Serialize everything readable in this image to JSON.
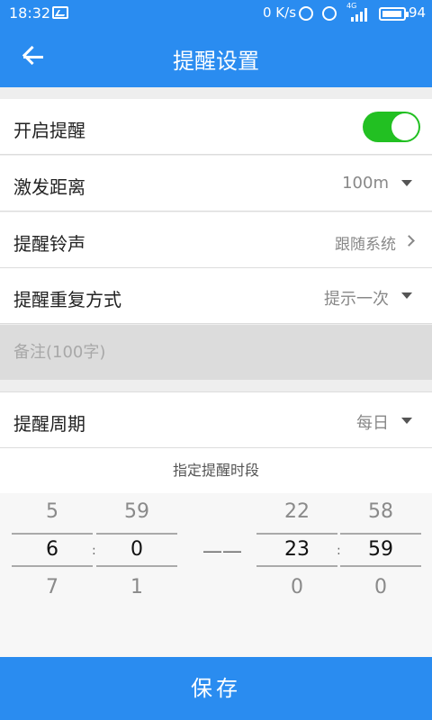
{
  "status_bar": {
    "time": "18:32",
    "speed": "0 K/s",
    "battery": "94",
    "network": "4G"
  },
  "app_bar": {
    "title": "提醒设置",
    "back_icon": "arrow-left-icon"
  },
  "settings": {
    "enable_reminder": {
      "label": "开启提醒",
      "on": true
    },
    "trigger_distance": {
      "label": "激发距离",
      "value": "100m"
    },
    "ringtone": {
      "label": "提醒铃声",
      "value": "跟随系统"
    },
    "repeat_mode": {
      "label": "提醒重复方式",
      "value": "提示一次"
    },
    "note": {
      "placeholder": "备注(100字)"
    },
    "period": {
      "label": "提醒周期",
      "value": "每日"
    }
  },
  "time_range": {
    "title": "指定提醒时段",
    "start_hour": {
      "prev": "5",
      "selected": "6",
      "next": "7"
    },
    "start_minute": {
      "prev": "59",
      "selected": "0",
      "next": "1"
    },
    "separator": "――",
    "end_hour": {
      "prev": "22",
      "selected": "23",
      "next": "0"
    },
    "end_minute": {
      "prev": "58",
      "selected": "59",
      "next": "0"
    }
  },
  "save_button": "保存",
  "colors": {
    "primary": "#2a8cf0",
    "toggle_on": "#22c022",
    "note_bg": "#dcdcdc"
  }
}
